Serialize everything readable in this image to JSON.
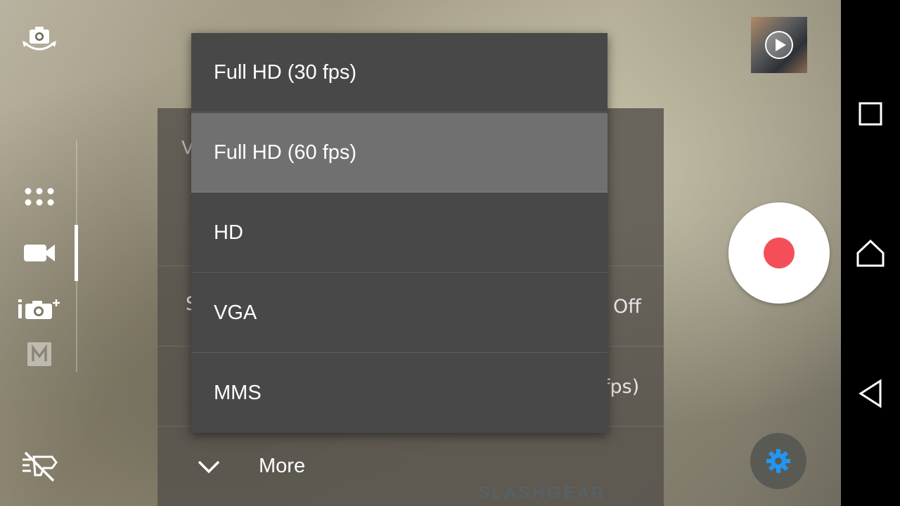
{
  "dropdown": {
    "options": [
      {
        "label": "Full HD (30 fps)",
        "selected": false
      },
      {
        "label": "Full HD (60 fps)",
        "selected": true
      },
      {
        "label": "HD",
        "selected": false
      },
      {
        "label": "VGA",
        "selected": false
      },
      {
        "label": "MMS",
        "selected": false
      }
    ]
  },
  "settings_panel": {
    "row0_partial": "V",
    "row2_partial": "S",
    "row2_value": "Off",
    "row3_value": "fps)",
    "more_label": "More"
  },
  "icons": {
    "switch_camera": "camera-switch-icon",
    "modes": "apps-grid-icon",
    "video_mode": "video-camera-icon",
    "superior_auto": "camera-plus-icon",
    "manual": "manual-mode-icon",
    "flash_off": "flash-off-icon",
    "settings": "gear-icon",
    "thumbnail_play": "play-icon"
  },
  "watermark": "SLASHGEAR",
  "colors": {
    "record": "#f44f58",
    "settings_gear": "#2196f3",
    "selected_row": "#707070",
    "dropdown_bg": "#484848"
  }
}
